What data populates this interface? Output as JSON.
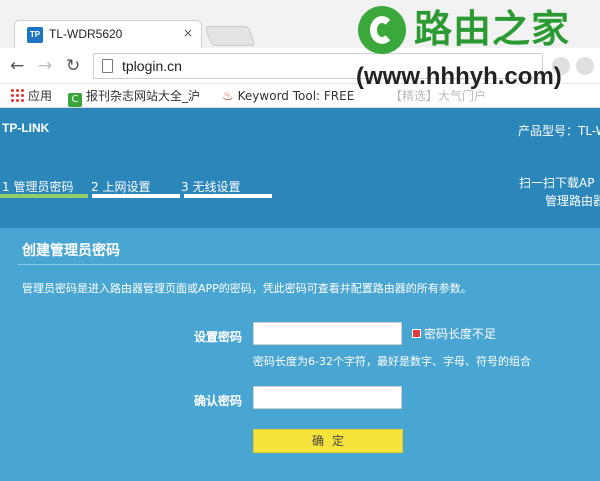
{
  "browser": {
    "tab_title": "TL-WDR5620",
    "tab_favicon_text": "TP",
    "tab_close": "×",
    "url": "tplogin.cn",
    "nav": {
      "back": "←",
      "forward": "→",
      "reload": "↻"
    },
    "bookmarks": [
      {
        "label": "应用"
      },
      {
        "label": "报刊杂志网站大全_沪"
      },
      {
        "label": "Keyword Tool: FREE"
      },
      {
        "label": "【精选】大气门户"
      }
    ]
  },
  "watermark": {
    "title": "路由之家",
    "url": "(www.hhhyh.com)"
  },
  "router": {
    "brand": "TP-LINK",
    "model_label": "产品型号：TL-W",
    "steps": [
      {
        "label": "1 管理员密码",
        "active": true
      },
      {
        "label": "2 上网设置",
        "active": false
      },
      {
        "label": "3 无线设置",
        "active": false
      }
    ],
    "scan_line1": "扫一扫下载AP",
    "scan_line2": "管理路由器",
    "panel": {
      "title": "创建管理员密码",
      "description": "管理员密码是进入路由器管理页面或APP的密码，凭此密码可查看并配置路由器的所有参数。",
      "set_password_label": "设置密码",
      "set_password_value": "",
      "error_text": "密码长度不足",
      "hint_text": "密码长度为6-32个字符，最好是数字、字母、符号的组合",
      "confirm_password_label": "确认密码",
      "confirm_password_value": "",
      "confirm_button": "确定"
    }
  },
  "colors": {
    "header_bg": "#2b86ba",
    "panel_bg": "#49a6d3",
    "active_step": "#8fd16a",
    "button_bg": "#f6e33b",
    "watermark_green": "#2c9a33"
  }
}
